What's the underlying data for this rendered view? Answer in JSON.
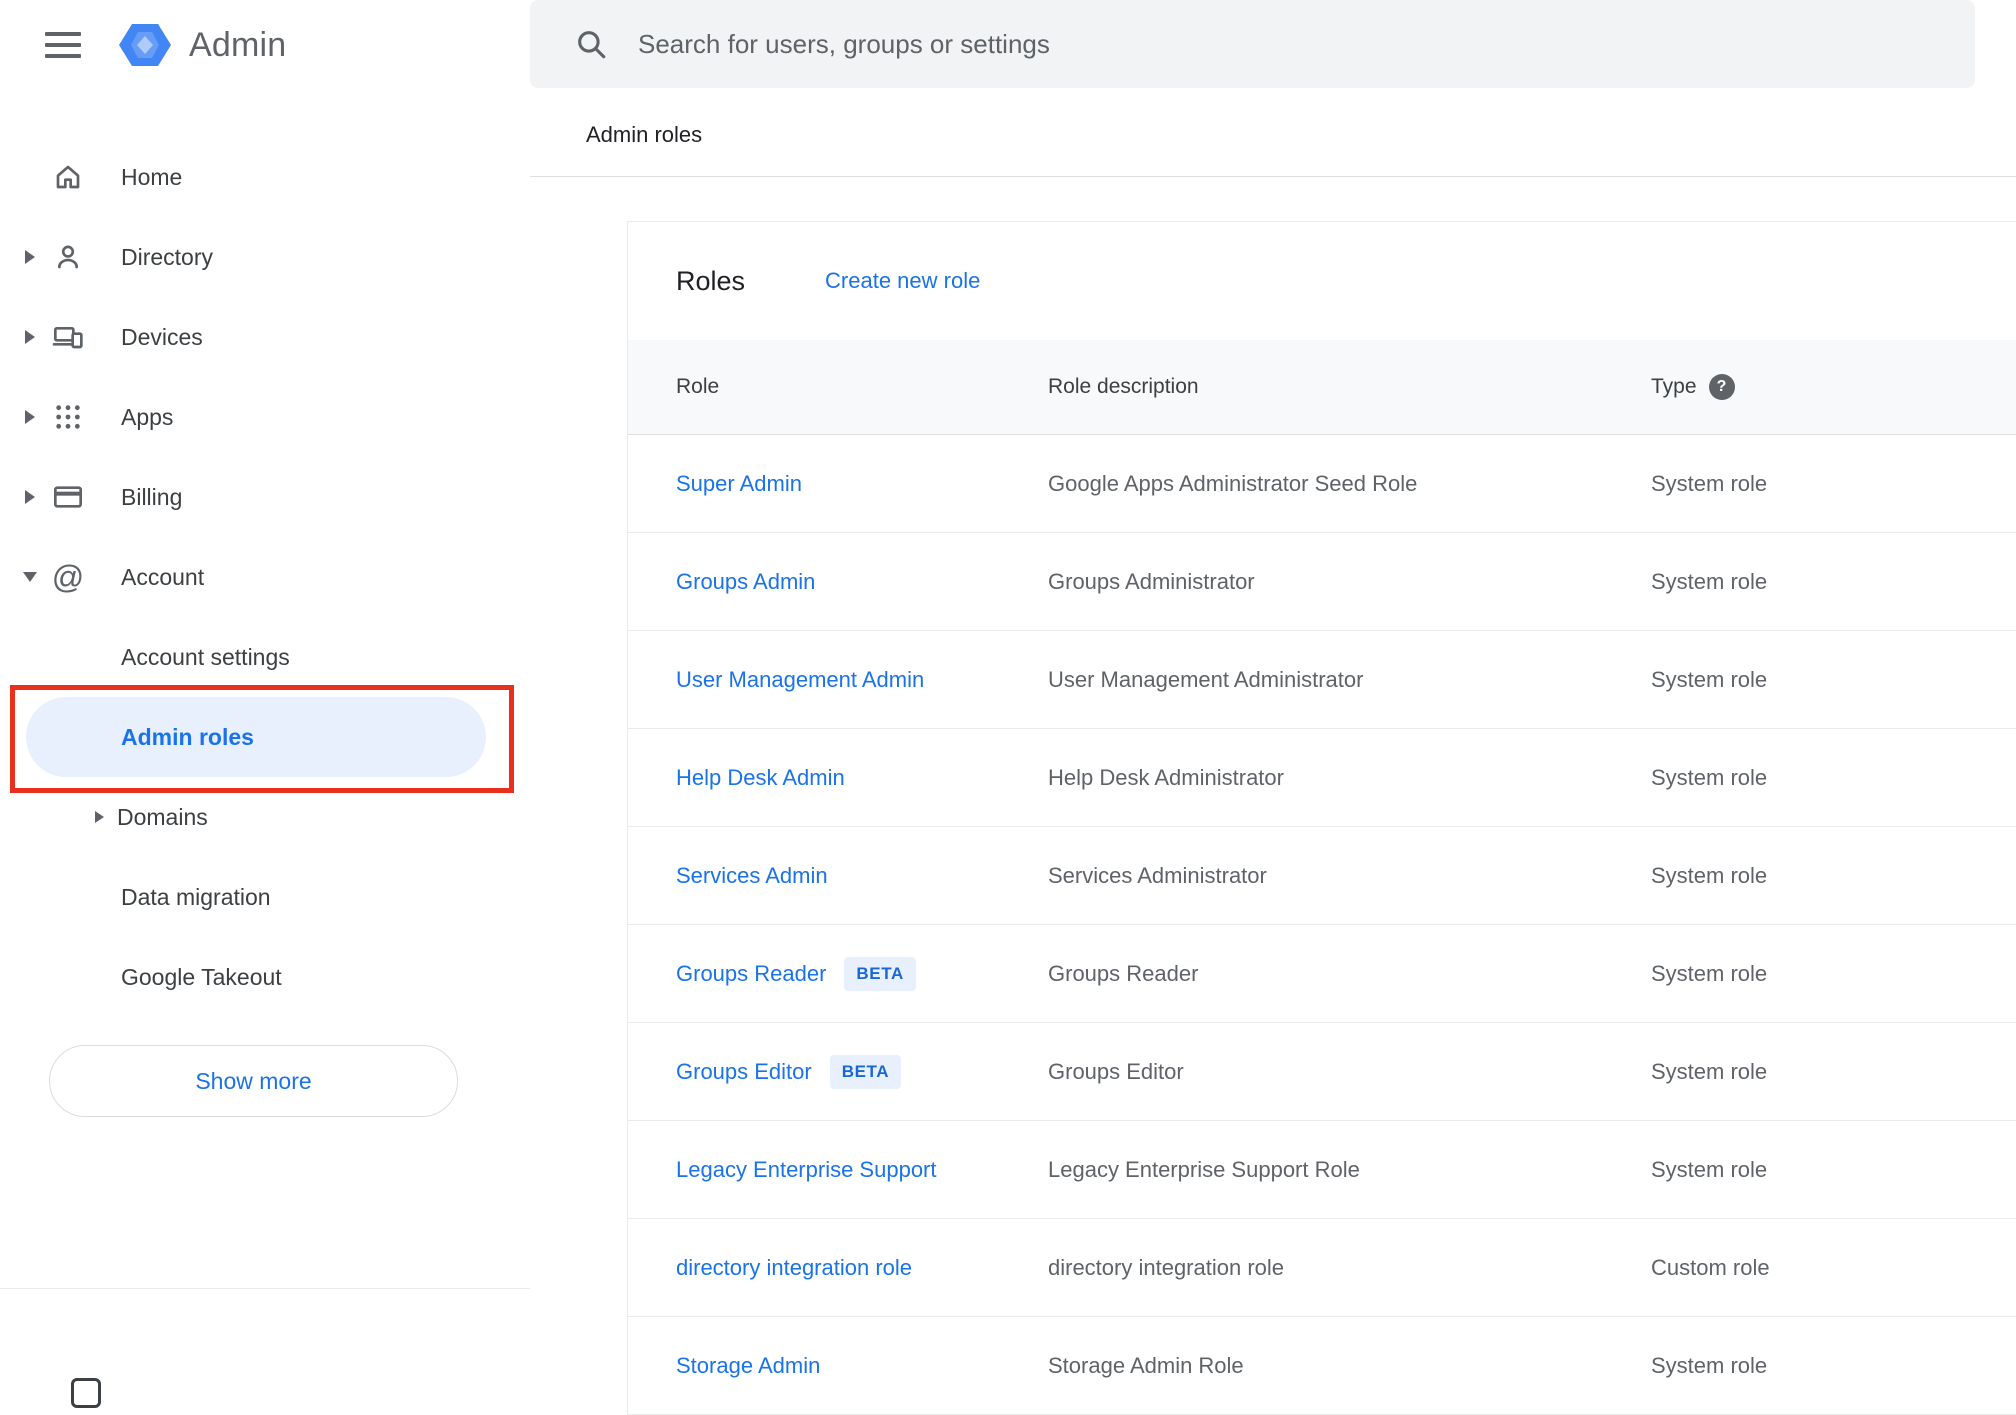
{
  "colors": {
    "link_blue": "#1a73e8",
    "selected_item_bg": "#e8f0fe",
    "annotation_red": "#e8301c",
    "search_bg": "#f1f3f4",
    "table_header_bg": "#f8f9fa",
    "logo_blue": "#4285f4"
  },
  "topbar": {
    "brand": "Admin",
    "search_placeholder": "Search for users, groups or settings"
  },
  "breadcrumb": "Admin roles",
  "sidebar": {
    "items": [
      {
        "label": "Home"
      },
      {
        "label": "Directory"
      },
      {
        "label": "Devices"
      },
      {
        "label": "Apps"
      },
      {
        "label": "Billing"
      },
      {
        "label": "Account"
      }
    ],
    "account_children": [
      {
        "label": "Account settings"
      },
      {
        "label": "Admin roles"
      },
      {
        "label": "Domains"
      },
      {
        "label": "Data migration"
      },
      {
        "label": "Google Takeout"
      }
    ],
    "show_more": "Show more"
  },
  "main": {
    "title": "Roles",
    "create_link": "Create new role",
    "table": {
      "headers": [
        "Role",
        "Role description",
        "Type"
      ],
      "rows": [
        {
          "role": "Super Admin",
          "description": "Google Apps Administrator Seed Role",
          "type": "System role"
        },
        {
          "role": "Groups Admin",
          "description": "Groups Administrator",
          "type": "System role"
        },
        {
          "role": "User Management Admin",
          "description": "User Management Administrator",
          "type": "System role"
        },
        {
          "role": "Help Desk Admin",
          "description": "Help Desk Administrator",
          "type": "System role"
        },
        {
          "role": "Services Admin",
          "description": "Services Administrator",
          "type": "System role"
        },
        {
          "role": "Groups Reader",
          "badge": "BETA",
          "description": "Groups Reader",
          "type": "System role"
        },
        {
          "role": "Groups Editor",
          "badge": "BETA",
          "description": "Groups Editor",
          "type": "System role"
        },
        {
          "role": "Legacy Enterprise Support",
          "description": "Legacy Enterprise Support Role",
          "type": "System role"
        },
        {
          "role": "directory integration role",
          "description": "directory integration role",
          "type": "Custom role"
        },
        {
          "role": "Storage Admin",
          "description": "Storage Admin Role",
          "type": "System role"
        }
      ]
    }
  }
}
